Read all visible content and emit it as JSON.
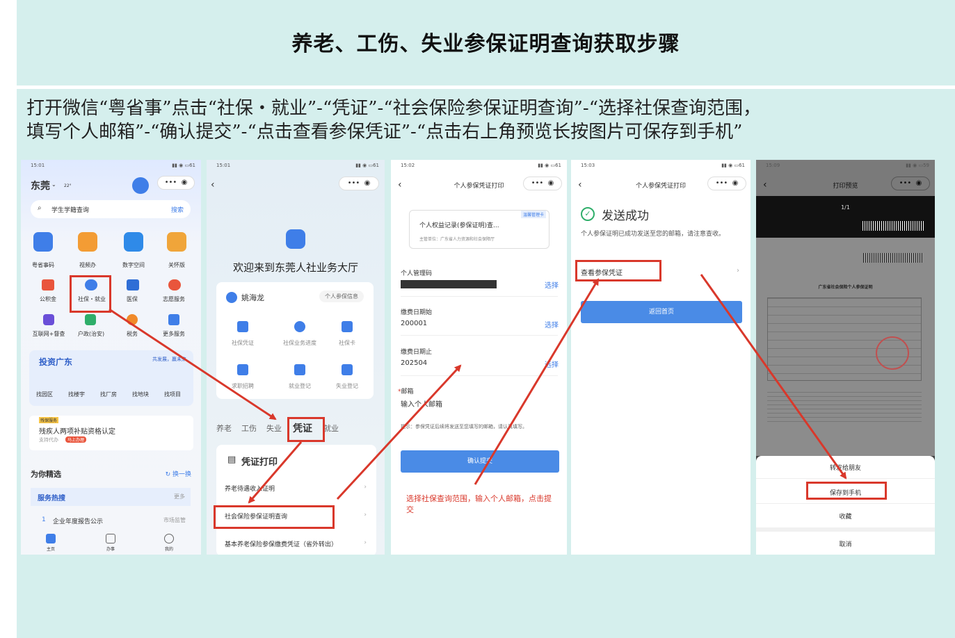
{
  "title": "养老、工伤、失业参保证明查询获取步骤",
  "instructions": [
    "打开微信“粤省事”点击“社保・就业”-“凭证”-“社会保险参保证明查询”-“选择社保查询范围，",
    "填写个人邮箱”-“确认提交”-“点击查看参保凭证”-“点击右上角预览长按图片可保存到手机”"
  ],
  "colors": {
    "accent_red": "#d9382b",
    "brand_blue": "#4a8be6",
    "background": "#d5efed"
  },
  "screen1": {
    "time": "15:01",
    "battery": "61",
    "city": "东莞",
    "temp": "22°",
    "search_placeholder": "学生学籍查询",
    "search_btn": "搜索",
    "row1": [
      "粤省事码",
      "视频办",
      "数字空间",
      "关怀版"
    ],
    "row2": [
      "公积金",
      "社保・就业",
      "医保",
      "志愿服务"
    ],
    "row3": [
      "互联网+督查",
      "户政(治安)",
      "税务",
      "更多服务"
    ],
    "banner_title": "投资广东",
    "banner_tag": "共发展，赢未来",
    "banner_items": [
      "找园区",
      "找楼宇",
      "找厂房",
      "找地块",
      "找项目"
    ],
    "promo_badge": "残保服务",
    "promo_title": "残疾人两项补贴资格认定",
    "promo_sub": "支持代办",
    "promo_tag": "马上办理",
    "section": "为你精选",
    "refresh": "换一换",
    "hot": "服务热搜",
    "more": "更多",
    "list_index": "1",
    "list_item": "企业年度报告公示",
    "list_dept": "市场监管",
    "tabs": [
      "主页",
      "办事",
      "我的"
    ]
  },
  "screen2": {
    "time": "15:01",
    "battery": "61",
    "welcome": "欢迎来到东莞人社业务大厅",
    "user": "姚海龙",
    "user_info": "个人参保信息",
    "grid1": [
      "社保凭证",
      "社保业务进度",
      "社保卡"
    ],
    "grid2": [
      "求职招聘",
      "就业登记",
      "失业登记"
    ],
    "tabs": [
      "养老",
      "工伤",
      "失业",
      "凭证",
      "就业"
    ],
    "section": "凭证打印",
    "items": [
      "养老待遇收入证明",
      "社会保险参保证明查询",
      "基本养老保险参保缴费凭证（省外转出）"
    ]
  },
  "screen3": {
    "time": "15:02",
    "battery": "61",
    "title": "个人参保凭证打印",
    "card_tag": "温馨管理卡",
    "card_title": "个人权益记录(参保证明)查...",
    "card_sub": "主管单位：广东省人力资源和社会保障厅",
    "field1": "个人管理码",
    "select": "选择",
    "field2": "缴费日期始",
    "field2_value": "200001",
    "field3": "缴费日期止",
    "field3_value": "202504",
    "field4": "邮箱",
    "field4_placeholder": "输入个人邮箱",
    "tip": "提示：参保凭证后续将发送至您填写的邮箱，请认真填写。",
    "submit": "确认提交",
    "note": "选择社保查询范围，输入个人邮箱，点击提交"
  },
  "screen4": {
    "time": "15:03",
    "battery": "61",
    "title": "个人参保凭证打印",
    "success": "发送成功",
    "desc": "个人参保证明已成功发送至您的邮箱，请注意查收。",
    "view": "查看参保凭证",
    "home": "返回首页"
  },
  "screen5": {
    "time": "15:09",
    "battery": "59",
    "title": "打印预览",
    "page": "1/1",
    "doc_title": "广东省社会保险个人参保证明",
    "menu": [
      "转发给朋友",
      "保存到手机",
      "收藏",
      "取消"
    ]
  }
}
